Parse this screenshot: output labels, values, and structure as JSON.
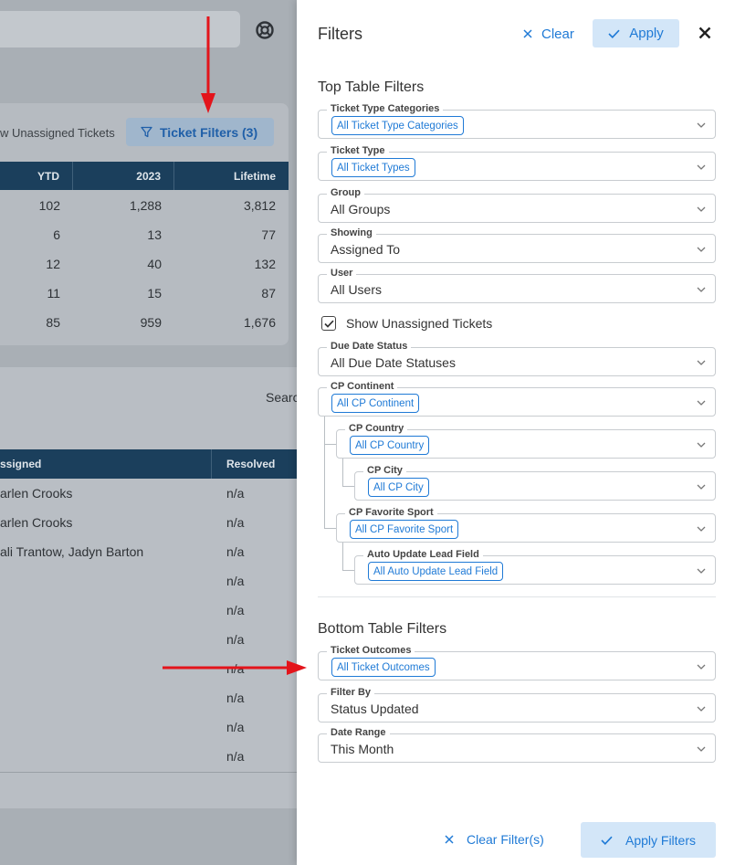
{
  "background": {
    "unassigned_label": "w Unassigned Tickets",
    "ticket_filters_button": "Ticket Filters (3)",
    "top_table": {
      "headers": [
        "YTD",
        "2023",
        "Lifetime"
      ],
      "rows": [
        [
          "102",
          "1,288",
          "3,812"
        ],
        [
          "6",
          "13",
          "77"
        ],
        [
          "12",
          "40",
          "132"
        ],
        [
          "11",
          "15",
          "87"
        ],
        [
          "85",
          "959",
          "1,676"
        ]
      ]
    },
    "search_label": "Searc",
    "bottom_table": {
      "headers": [
        "ssigned",
        "Resolved"
      ],
      "rows": [
        [
          "arlen Crooks",
          "n/a"
        ],
        [
          "arlen Crooks",
          "n/a"
        ],
        [
          "ali Trantow,  Jadyn Barton",
          "n/a"
        ],
        [
          "",
          "n/a"
        ],
        [
          "",
          "n/a"
        ],
        [
          "",
          "n/a"
        ],
        [
          "",
          "n/a"
        ],
        [
          "",
          "n/a"
        ],
        [
          "",
          "n/a"
        ],
        [
          "",
          "n/a"
        ]
      ]
    }
  },
  "drawer": {
    "title": "Filters",
    "clear_label": "Clear",
    "apply_label": "Apply",
    "top_section_title": "Top Table Filters",
    "bottom_section_title": "Bottom Table Filters",
    "show_unassigned_label": "Show Unassigned Tickets",
    "show_unassigned_checked": true,
    "fields": {
      "ticket_type_categories": {
        "label": "Ticket Type Categories",
        "value": "All Ticket Type Categories"
      },
      "ticket_type": {
        "label": "Ticket Type",
        "value": "All Ticket Types"
      },
      "group": {
        "label": "Group",
        "value": "All Groups"
      },
      "showing": {
        "label": "Showing",
        "value": "Assigned To"
      },
      "user": {
        "label": "User",
        "value": "All Users"
      },
      "due_date_status": {
        "label": "Due Date Status",
        "value": "All Due Date Statuses"
      },
      "cp_continent": {
        "label": "CP Continent",
        "value": "All CP Continent"
      },
      "cp_country": {
        "label": "CP Country",
        "value": "All CP Country"
      },
      "cp_city": {
        "label": "CP City",
        "value": "All CP City"
      },
      "cp_favorite_sport": {
        "label": "CP Favorite Sport",
        "value": "All CP Favorite Sport"
      },
      "auto_update_lead_field": {
        "label": "Auto Update Lead Field",
        "value": "All Auto Update Lead Field"
      },
      "ticket_outcomes": {
        "label": "Ticket Outcomes",
        "value": "All Ticket Outcomes"
      },
      "filter_by": {
        "label": "Filter By",
        "value": "Status Updated"
      },
      "date_range": {
        "label": "Date Range",
        "value": "This Month"
      }
    },
    "footer": {
      "clear_filters_label": "Clear Filter(s)",
      "apply_filters_label": "Apply Filters"
    }
  },
  "colors": {
    "accent": "#1f7ad6",
    "accent_bg": "#d3e6f8",
    "table_header": "#1b3f5c",
    "annotation_arrow": "#e3141b"
  }
}
